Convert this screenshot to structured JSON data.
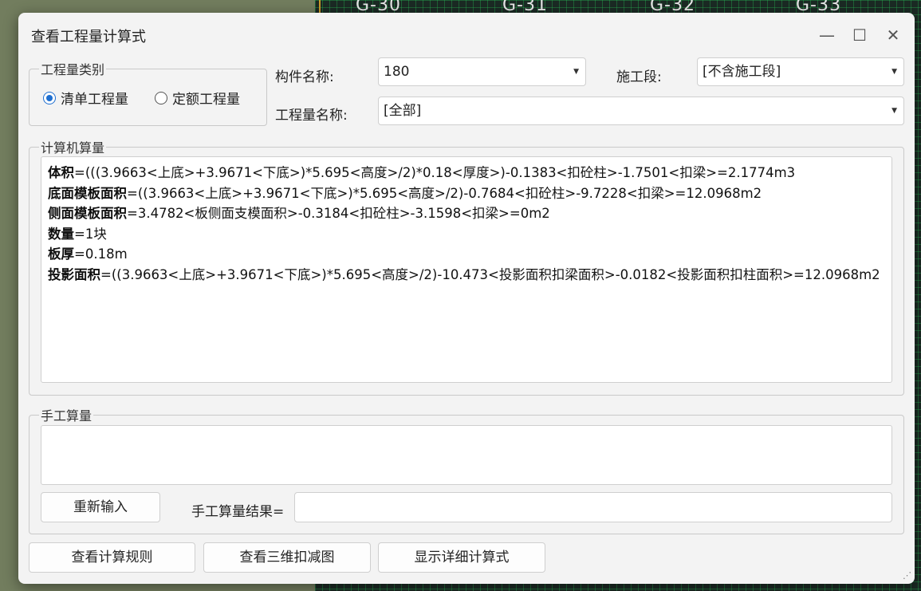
{
  "background": {
    "grid_labels": [
      "G-30",
      "G-31",
      "G-32",
      "G-33"
    ]
  },
  "window": {
    "title": "查看工程量计算式",
    "minimize_label": "—",
    "maximize_label": "☐",
    "close_label": "✕"
  },
  "quantity_type": {
    "legend": "工程量类别",
    "options": [
      "清单工程量",
      "定额工程量"
    ],
    "selected": "清单工程量"
  },
  "component": {
    "label": "构件名称:",
    "value": "180"
  },
  "stage": {
    "label": "施工段:",
    "value": "[不含施工段]"
  },
  "quantity_name": {
    "label": "工程量名称:",
    "value": "[全部]"
  },
  "computer_calc": {
    "legend": "计算机算量",
    "lines": [
      {
        "name": "体积",
        "formula": "=(((3.9663<上底>+3.9671<下底>)*5.695<高度>/2)*0.18<厚度>)-0.1383<扣砼柱>-1.7501<扣梁>=2.1774m3"
      },
      {
        "name": "底面模板面积",
        "formula": "=((3.9663<上底>+3.9671<下底>)*5.695<高度>/2)-0.7684<扣砼柱>-9.7228<扣梁>=12.0968m2"
      },
      {
        "name": "侧面模板面积",
        "formula": "=3.4782<板侧面支模面积>-0.3184<扣砼柱>-3.1598<扣梁>=0m2"
      },
      {
        "name": "数量",
        "formula": "=1块"
      },
      {
        "name": "板厚",
        "formula": "=0.18m"
      },
      {
        "name": "投影面积",
        "formula": "=((3.9663<上底>+3.9671<下底>)*5.695<高度>/2)-10.473<投影面积扣梁面积>-0.0182<投影面积扣柱面积>=12.0968m2"
      }
    ]
  },
  "manual_calc": {
    "legend": "手工算量",
    "reenter_button": "重新输入",
    "result_label": "手工算量结果=",
    "result_value": ""
  },
  "footer": {
    "rules_button": "查看计算规则",
    "view3d_button": "查看三维扣减图",
    "detail_button": "显示详细计算式"
  }
}
